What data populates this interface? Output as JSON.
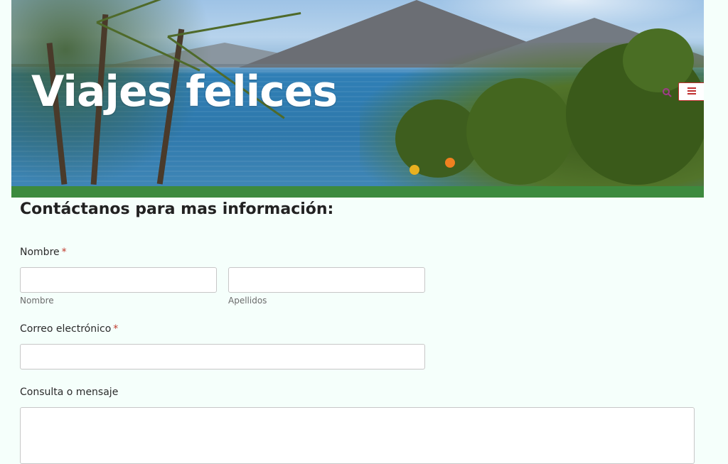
{
  "site": {
    "title": "Viajes felices"
  },
  "header": {
    "search_icon": "search-icon",
    "menu_icon": "hamburger-menu-icon",
    "accent_border_color": "#c03030",
    "bar_color": "#3d8a3e"
  },
  "form": {
    "heading": "Contáctanos para mas información:",
    "name": {
      "label": "Nombre",
      "required_mark": "*",
      "first_value": "",
      "first_sublabel": "Nombre",
      "last_value": "",
      "last_sublabel": "Apellidos"
    },
    "email": {
      "label": "Correo electrónico",
      "required_mark": "*",
      "value": ""
    },
    "message": {
      "label": "Consulta o mensaje",
      "value": ""
    }
  }
}
